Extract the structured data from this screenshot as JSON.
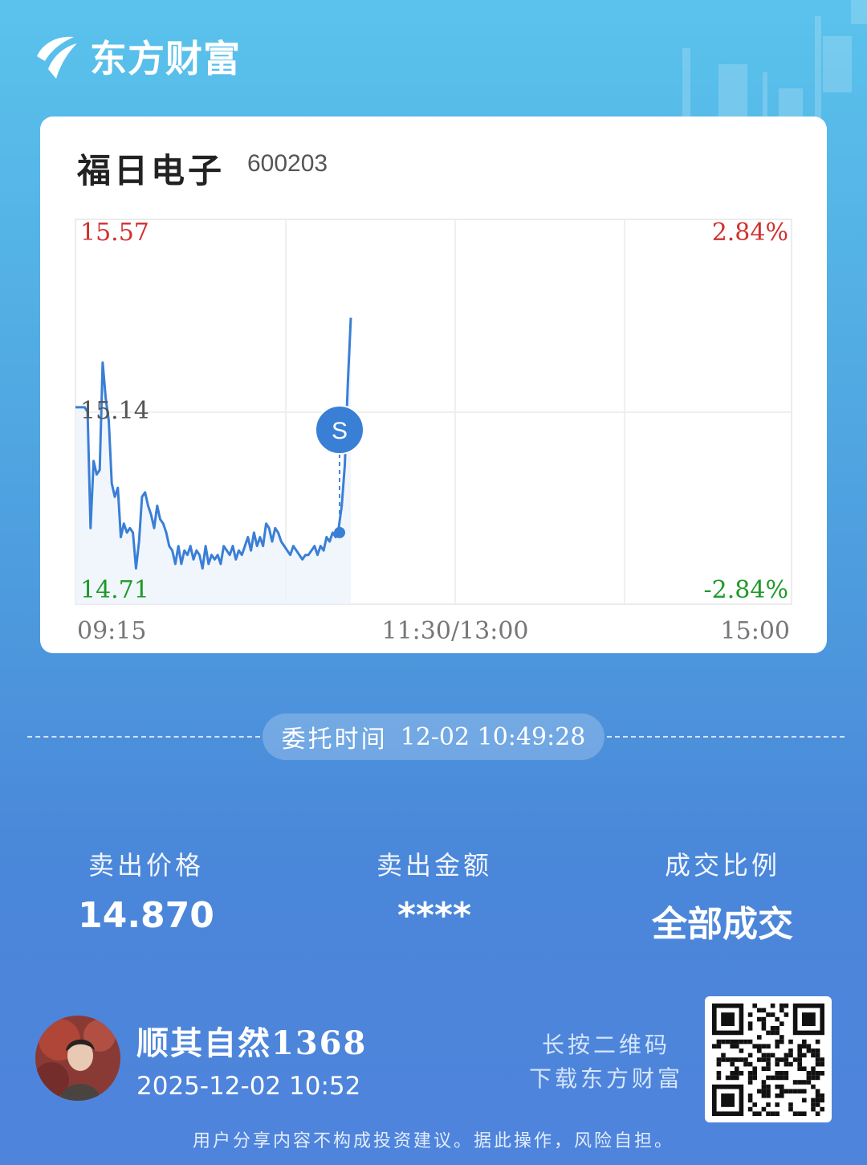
{
  "brand": {
    "name": "东方财富",
    "logo_icon": "eastmoney-logo-icon"
  },
  "stock": {
    "name": "福日电子",
    "code": "600203"
  },
  "chart_data": {
    "type": "line",
    "title": "",
    "price_top": "15.57",
    "price_mid": "15.14",
    "price_bottom": "14.71",
    "pct_top": "2.84%",
    "pct_bottom": "-2.84%",
    "x_start_label": "09:15",
    "x_mid_label": "11:30/13:00",
    "x_end_label": "15:00",
    "ylim": [
      14.71,
      15.57
    ],
    "series": [
      {
        "values": [
          15.15,
          15.15,
          15.15,
          15.15,
          15.14,
          14.88,
          15.03,
          15.0,
          15.01,
          15.25,
          15.17,
          15.12,
          14.98,
          14.95,
          14.97,
          14.86,
          14.89,
          14.87,
          14.88,
          14.87,
          14.79,
          14.85,
          14.95,
          14.96,
          14.93,
          14.91,
          14.88,
          14.93,
          14.9,
          14.89,
          14.87,
          14.84,
          14.83,
          14.8,
          14.84,
          14.8,
          14.83,
          14.82,
          14.84,
          14.81,
          14.83,
          14.82,
          14.79,
          14.84,
          14.8,
          14.82,
          14.81,
          14.82,
          14.8,
          14.84,
          14.83,
          14.82,
          14.84,
          14.81,
          14.83,
          14.82,
          14.84,
          14.86,
          14.83,
          14.87,
          14.84,
          14.86,
          14.84,
          14.89,
          14.88,
          14.85,
          14.88,
          14.87,
          14.85,
          14.84,
          14.83,
          14.82,
          14.84,
          14.83,
          14.82,
          14.81,
          14.82,
          14.82,
          14.83,
          14.84,
          14.82,
          14.84,
          14.83,
          14.86,
          14.85,
          14.87,
          14.86,
          14.88,
          14.93,
          15.02,
          15.2,
          15.35
        ]
      }
    ],
    "sell_marker": {
      "label": "S",
      "price": 14.87
    }
  },
  "order": {
    "label": "委托时间",
    "datetime": "12-02 10:49:28"
  },
  "stats": [
    {
      "label": "卖出价格",
      "value": "14.870"
    },
    {
      "label": "卖出金额",
      "value": "****"
    },
    {
      "label": "成交比例",
      "value": "全部成交"
    }
  ],
  "user": {
    "name": "顺其自然1368",
    "share_time": "2025-12-02 10:52",
    "avatar_icon": "user-avatar"
  },
  "qr": {
    "hint_line1": "长按二维码",
    "hint_line2": "下载东方财富",
    "icon": "qr-code-icon"
  },
  "disclaimer": "用户分享内容不构成投资建议。据此操作，风险自担。",
  "colors": {
    "up": "#d0302f",
    "down": "#1f9a2a",
    "line": "#3a7fd6"
  }
}
